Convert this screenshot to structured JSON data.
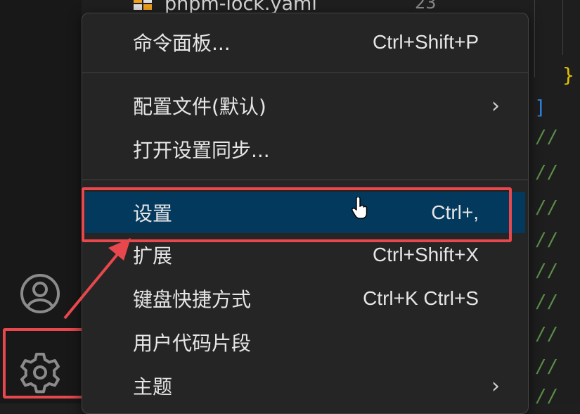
{
  "explorer": {
    "file_name": "pnpm-lock.yaml",
    "file_count": "23"
  },
  "menu": {
    "items": [
      {
        "label": "命令面板...",
        "shortcut": "Ctrl+Shift+P"
      },
      {
        "label": "配置文件(默认)",
        "shortcut": "",
        "submenu": true
      },
      {
        "label": "打开设置同步...",
        "shortcut": ""
      },
      {
        "label": "设置",
        "shortcut": "Ctrl+,",
        "selected": true
      },
      {
        "label": "扩展",
        "shortcut": "Ctrl+Shift+X"
      },
      {
        "label": "键盘快捷方式",
        "shortcut": "Ctrl+K Ctrl+S"
      },
      {
        "label": "用户代码片段",
        "shortcut": ""
      },
      {
        "label": "主题",
        "shortcut": "",
        "submenu": true
      }
    ]
  },
  "editor": {
    "comment_prefix": "//"
  },
  "colors": {
    "highlight_border": "#e8474d",
    "selected_background": "#04395e",
    "menu_background": "#252526"
  },
  "icons": [
    "account-icon",
    "gear-icon",
    "chevron-right-icon",
    "pointer-hand-icon",
    "file-icon"
  ]
}
